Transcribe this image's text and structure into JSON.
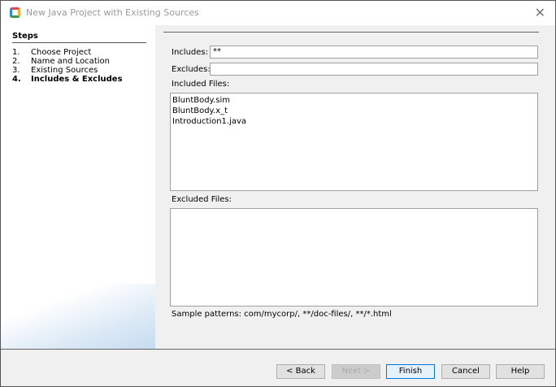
{
  "window": {
    "title": "New Java Project with Existing Sources",
    "close_icon": "close-icon"
  },
  "steps": {
    "heading": "Steps",
    "items": [
      {
        "num": "1.",
        "label": "Choose Project"
      },
      {
        "num": "2.",
        "label": "Name and Location"
      },
      {
        "num": "3.",
        "label": "Existing Sources"
      },
      {
        "num": "4.",
        "label": "Includes & Excludes"
      }
    ]
  },
  "form": {
    "includes_label": "Includes:",
    "includes_value": "**",
    "excludes_label": "Excludes:",
    "excludes_value": "",
    "included_files_label": "Included Files:",
    "included_files": [
      "BluntBody.sim",
      "BluntBody.x_t",
      "Introduction1.java"
    ],
    "excluded_files_label": "Excluded Files:",
    "sample_patterns": "Sample patterns: com/mycorp/, **/doc-files/, **/*.html"
  },
  "buttons": {
    "back": "< Back",
    "next": "Next >",
    "finish": "Finish",
    "cancel": "Cancel",
    "help": "Help"
  }
}
